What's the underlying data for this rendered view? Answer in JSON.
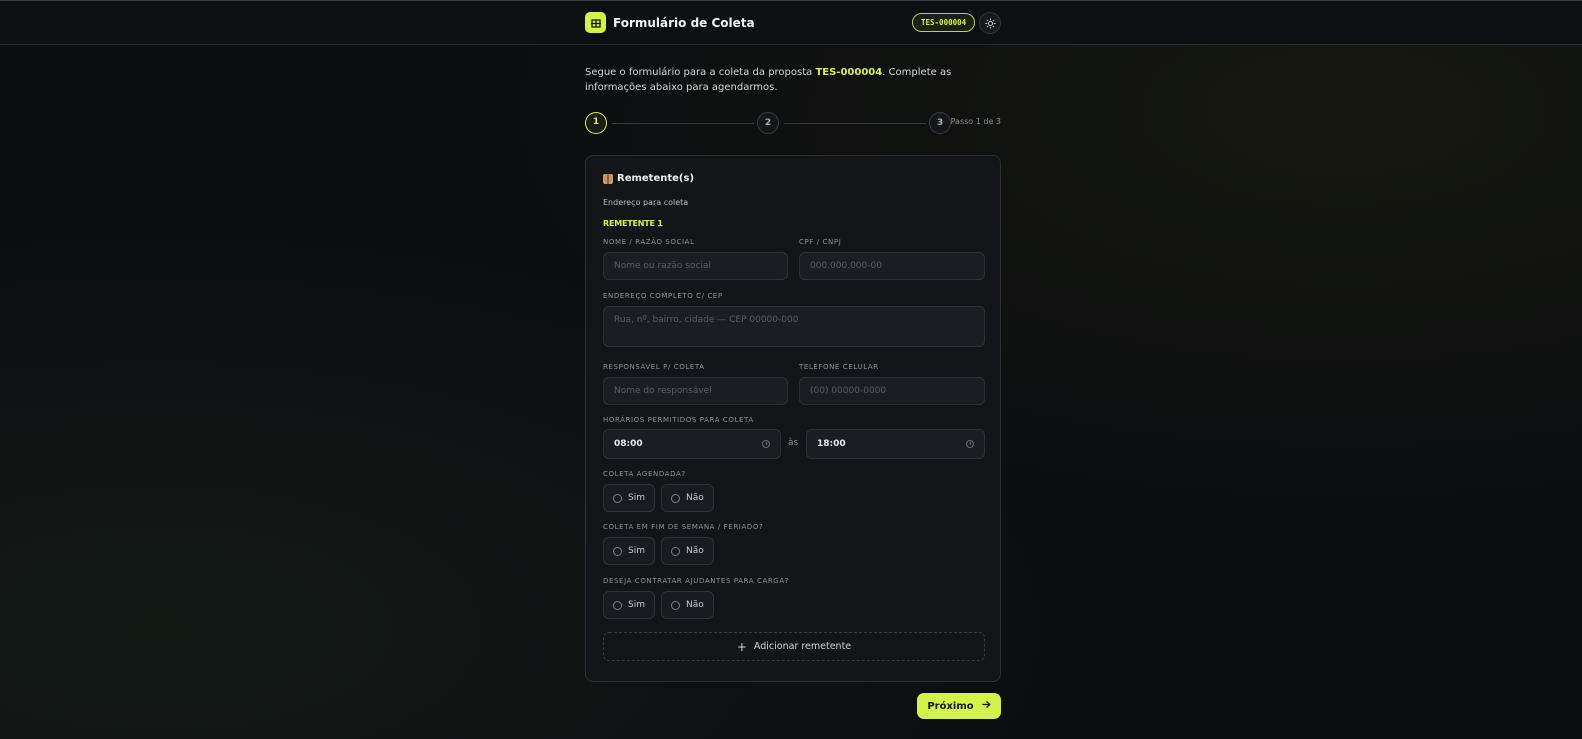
{
  "header": {
    "app_title": "Formulário de Coleta",
    "proposal_badge": "TES-000004"
  },
  "intro": {
    "text_before": "Segue o formulário para a coleta da proposta ",
    "proposal_code": "TES-000004",
    "text_after": ". Complete as informações abaixo para agendarmos."
  },
  "stepper": {
    "steps": [
      "1",
      "2",
      "3"
    ],
    "current_step": 1,
    "progress_label": "Passo 1 de 3"
  },
  "section": {
    "title": "Remetente(s)",
    "subtitle": "Endereço para coleta",
    "sender_label": "REMETENTE 1"
  },
  "fields": {
    "name": {
      "label": "NOME / RAZÃO SOCIAL",
      "placeholder": "Nome ou razão social"
    },
    "doc": {
      "label": "CPF / CNPJ",
      "placeholder": "000.000.000-00"
    },
    "address": {
      "label": "ENDEREÇO COMPLETO C/ CEP",
      "placeholder": "Rua, nº, bairro, cidade — CEP 00000-000"
    },
    "responsible": {
      "label": "RESPONSÁVEL P/ COLETA",
      "placeholder": "Nome do responsável"
    },
    "phone": {
      "label": "TELEFONE CELULAR",
      "placeholder": "(00) 00000-0000"
    },
    "hours": {
      "label": "HORÁRIOS PERMITIDOS PARA COLETA",
      "from": "08:00",
      "separator": "às",
      "to": "18:00"
    }
  },
  "questions": [
    {
      "label": "COLETA AGENDADA?",
      "options": [
        "Sim",
        "Não"
      ]
    },
    {
      "label": "COLETA EM FIM DE SEMANA / FERIADO?",
      "options": [
        "Sim",
        "Não"
      ]
    },
    {
      "label": "DESEJA CONTRATAR AJUDANTES PARA CARGA?",
      "options": [
        "Sim",
        "Não"
      ]
    }
  ],
  "actions": {
    "add_sender": "Adicionar remetente",
    "next": "Próximo"
  },
  "colors": {
    "accent": "#d4f24a",
    "background": "#0c0d10",
    "card": "#141519"
  },
  "icons": [
    "building-icon",
    "sun-icon",
    "package-icon",
    "clock-icon",
    "plus-icon",
    "arrow-right-icon"
  ]
}
